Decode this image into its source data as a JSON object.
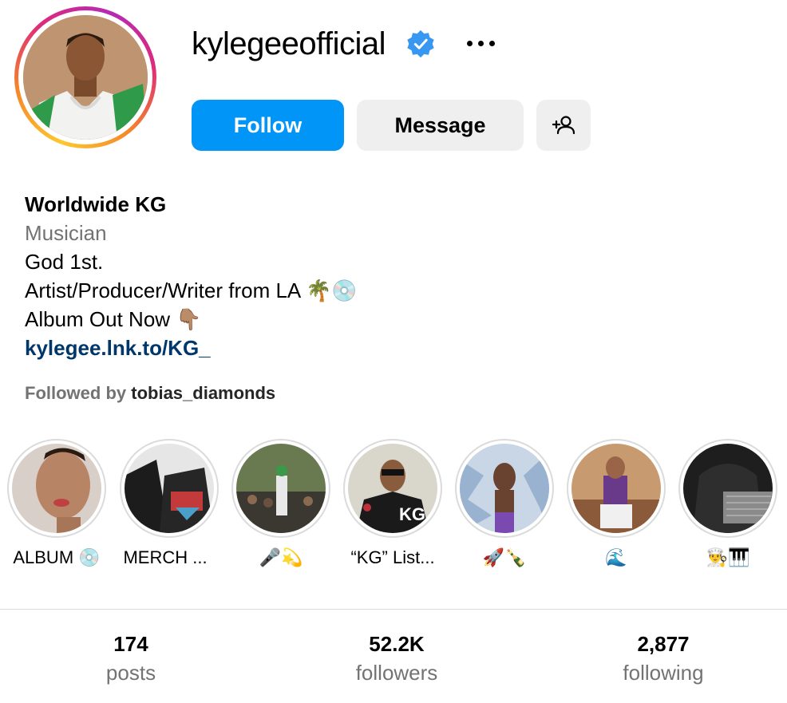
{
  "profile": {
    "username": "kylegeeofficial",
    "follow_label": "Follow",
    "message_label": "Message",
    "name": "Worldwide KG",
    "category": "Musician",
    "bio_line1": "God 1st.",
    "bio_line2": "Artist/Producer/Writer from LA 🌴💿",
    "bio_line3": "Album Out Now 👇🏽",
    "link": "kylegee.lnk.to/KG_",
    "followed_by_prefix": "Followed by",
    "followed_by_user": "tobias_diamonds"
  },
  "highlights": [
    {
      "label": "ALBUM 💿"
    },
    {
      "label": "MERCH ..."
    },
    {
      "label": "🎤💫"
    },
    {
      "label": "“KG” List..."
    },
    {
      "label": "🚀🍾"
    },
    {
      "label": "🌊"
    },
    {
      "label": "👨‍🍳🎹"
    }
  ],
  "stats": [
    {
      "value": "174",
      "label": "posts"
    },
    {
      "value": "52.2K",
      "label": "followers"
    },
    {
      "value": "2,877",
      "label": "following"
    }
  ],
  "colors": {
    "follow_button": "#0095f6",
    "secondary_button": "#efefef",
    "verified_badge": "#3897f0",
    "link": "#00376b",
    "muted_text": "#737373"
  }
}
